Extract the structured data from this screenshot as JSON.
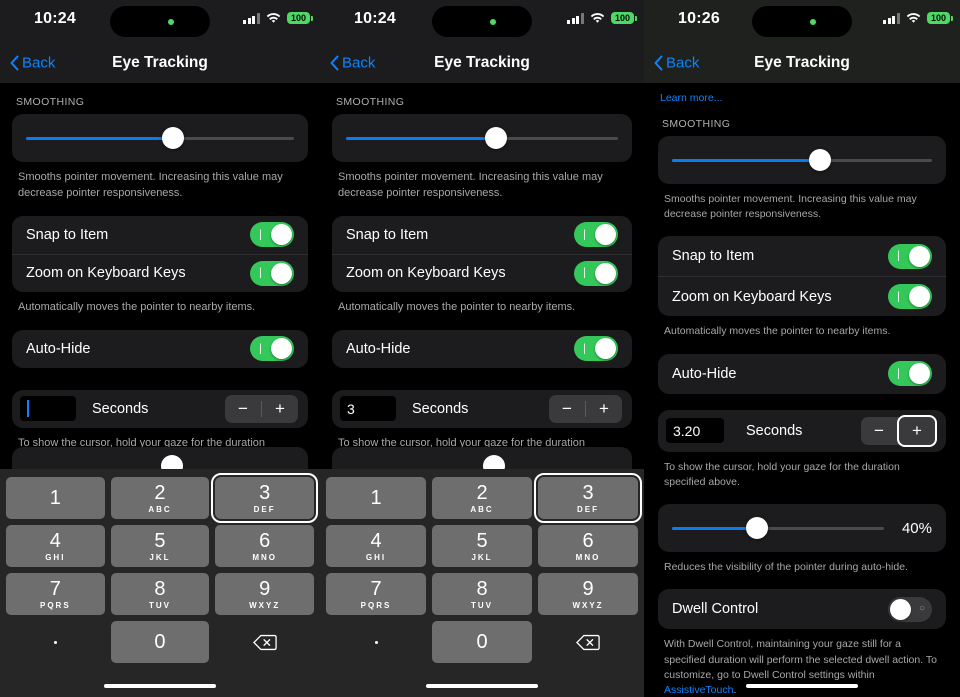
{
  "panels": [
    {
      "status": {
        "time": "10:24",
        "signal_icon": "cellular-signal-icon",
        "wifi_icon": "wifi-icon",
        "battery": "100"
      },
      "nav": {
        "back_label": "Back",
        "title": "Eye Tracking"
      },
      "smoothing": {
        "header": "SMOOTHING",
        "value_pct": 55,
        "caption": "Smooths pointer movement. Increasing this value may decrease pointer responsiveness."
      },
      "toggles": {
        "snap_label": "Snap to Item",
        "snap_on": true,
        "zoom_label": "Zoom on Keyboard Keys",
        "zoom_on": true,
        "caption": "Automatically moves the pointer to nearby items."
      },
      "autohide": {
        "label": "Auto-Hide",
        "on": true
      },
      "stepper": {
        "value": "",
        "show_caret": true,
        "unit_label": "Seconds",
        "minus_label": "−",
        "plus_label": "+",
        "focused": "none",
        "caption": "To show the cursor, hold your gaze for the duration specified above."
      },
      "keypad": {
        "visible": true,
        "keys": [
          {
            "digit": "1",
            "letters": ""
          },
          {
            "digit": "2",
            "letters": "ABC"
          },
          {
            "digit": "3",
            "letters": "DEF",
            "focused": true
          },
          {
            "digit": "4",
            "letters": "GHI"
          },
          {
            "digit": "5",
            "letters": "JKL"
          },
          {
            "digit": "6",
            "letters": "MNO"
          },
          {
            "digit": "7",
            "letters": "PQRS"
          },
          {
            "digit": "8",
            "letters": "TUV"
          },
          {
            "digit": "9",
            "letters": "WXYZ"
          },
          {
            "digit": ".",
            "letters": "",
            "type": "dot"
          },
          {
            "digit": "0",
            "letters": ""
          },
          {
            "digit": "",
            "letters": "",
            "type": "delete"
          }
        ]
      }
    },
    {
      "status": {
        "time": "10:24",
        "battery": "100"
      },
      "nav": {
        "back_label": "Back",
        "title": "Eye Tracking"
      },
      "smoothing": {
        "header": "SMOOTHING",
        "value_pct": 55,
        "caption": "Smooths pointer movement. Increasing this value may decrease pointer responsiveness."
      },
      "toggles": {
        "snap_label": "Snap to Item",
        "snap_on": true,
        "zoom_label": "Zoom on Keyboard Keys",
        "zoom_on": true,
        "caption": "Automatically moves the pointer to nearby items."
      },
      "autohide": {
        "label": "Auto-Hide",
        "on": true
      },
      "stepper": {
        "value": "3",
        "show_caret": false,
        "unit_label": "Seconds",
        "minus_label": "−",
        "plus_label": "+",
        "focused": "none",
        "caption": "To show the cursor, hold your gaze for the duration specified above."
      },
      "keypad": {
        "visible": true
      }
    },
    {
      "status": {
        "time": "10:26",
        "battery": "100"
      },
      "nav": {
        "back_label": "Back",
        "title": "Eye Tracking"
      },
      "learn_more": "Learn more...",
      "smoothing": {
        "header": "SMOOTHING",
        "value_pct": 57,
        "caption": "Smooths pointer movement. Increasing this value may decrease pointer responsiveness."
      },
      "toggles": {
        "snap_label": "Snap to Item",
        "snap_on": true,
        "zoom_label": "Zoom on Keyboard Keys",
        "zoom_on": true,
        "caption": "Automatically moves the pointer to nearby items."
      },
      "autohide": {
        "label": "Auto-Hide",
        "on": true
      },
      "stepper": {
        "value": "3.20",
        "show_caret": false,
        "unit_label": "Seconds",
        "minus_label": "−",
        "plus_label": "+",
        "focused": "plus",
        "caption": "To show the cursor, hold your gaze for the duration specified above."
      },
      "opacity": {
        "value_pct": 40,
        "value_label": "40%",
        "caption": "Reduces the visibility of the pointer during auto-hide."
      },
      "dwell": {
        "label": "Dwell Control",
        "on": false,
        "caption_pre": "With Dwell Control, maintaining your gaze still for a specified duration will perform the selected dwell action. To customize, go to Dwell Control settings within ",
        "caption_link": "AssistiveTouch",
        "caption_post": "."
      }
    }
  ],
  "colors": {
    "accent_blue": "#0a84ff",
    "slider_blue": "#0a7cf0",
    "toggle_green": "#34c759",
    "battery_green": "#4cd964",
    "card_bg": "#1c1c1e",
    "key_bg": "#6e6e6e",
    "keypad_bg": "#262626"
  }
}
